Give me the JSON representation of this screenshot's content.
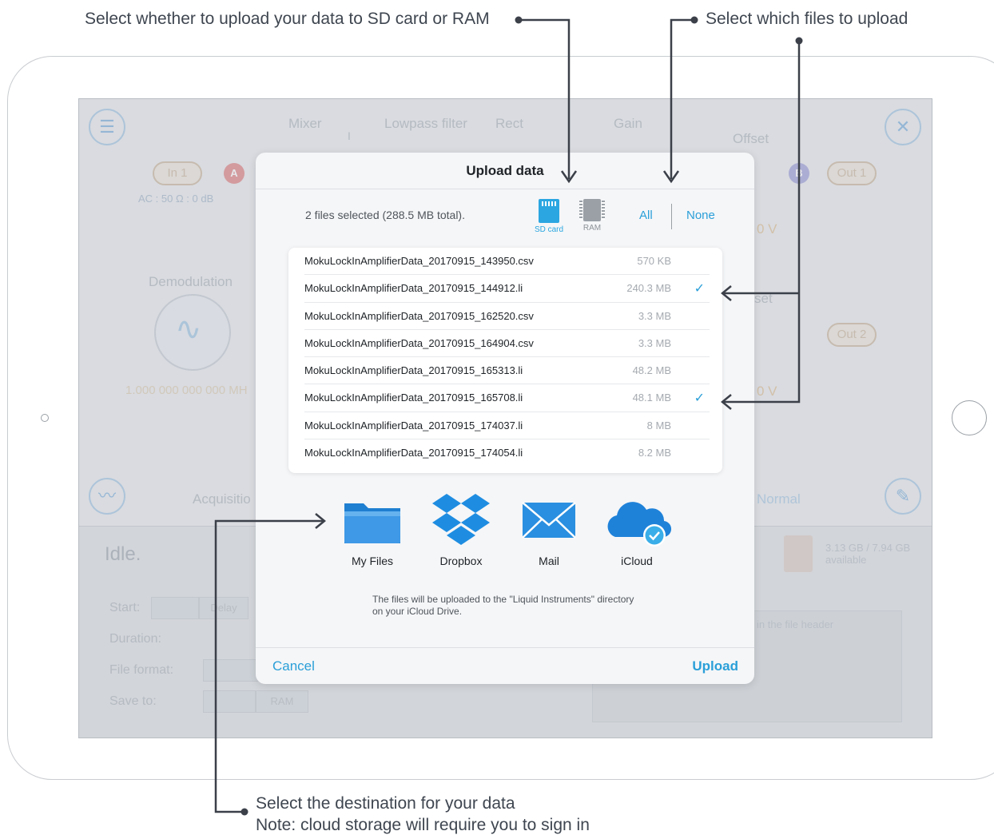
{
  "callouts": {
    "storage": "Select whether to upload your data to SD card or RAM",
    "files": "Select which files to upload",
    "destination_line1": "Select the destination for your data",
    "destination_line2": "Note: cloud storage will require you to sign in"
  },
  "background": {
    "labels": {
      "mixer": "Mixer",
      "lowpass": "Lowpass filter",
      "rect": "Rect",
      "gain": "Gain",
      "offset": "Offset",
      "offset2": "set",
      "demodulation": "Demodulation",
      "acquisition": "Acquisitio",
      "normal": "Normal",
      "idle": "Idle.",
      "in1": "In 1",
      "out1": "Out 1",
      "out2": "Out 2",
      "badge_a": "A",
      "badge_b": "B",
      "input_settings": "AC : 50 Ω : 0 dB",
      "frequency": "1.000 000 000 000 MH",
      "volt1": "0 V",
      "volt2": "0 V",
      "mixer_i": "I",
      "storage_info": "3.13 GB / 7.94 GB",
      "storage_available": "available",
      "start": "Start:",
      "start_delay": "Delay",
      "duration": "Duration:",
      "file_format": "File format:",
      "save_to": "Save to:",
      "save_to_value": "RAM",
      "file_header_hint": "in the file header"
    }
  },
  "modal": {
    "title": "Upload data",
    "selection_summary": "2 files selected (288.5 MB total).",
    "storage_options": [
      {
        "label": "SD card",
        "selected": true
      },
      {
        "label": "RAM",
        "selected": false
      }
    ],
    "select_all": "All",
    "select_none": "None",
    "files": [
      {
        "name": "MokuLockInAmplifierData_20170915_143950.csv",
        "size": "570 KB",
        "checked": false
      },
      {
        "name": "MokuLockInAmplifierData_20170915_144912.li",
        "size": "240.3 MB",
        "checked": true
      },
      {
        "name": "MokuLockInAmplifierData_20170915_162520.csv",
        "size": "3.3 MB",
        "checked": false
      },
      {
        "name": "MokuLockInAmplifierData_20170915_164904.csv",
        "size": "3.3 MB",
        "checked": false
      },
      {
        "name": "MokuLockInAmplifierData_20170915_165313.li",
        "size": "48.2 MB",
        "checked": false
      },
      {
        "name": "MokuLockInAmplifierData_20170915_165708.li",
        "size": "48.1 MB",
        "checked": true
      },
      {
        "name": "MokuLockInAmplifierData_20170915_174037.li",
        "size": "8 MB",
        "checked": false
      },
      {
        "name": "MokuLockInAmplifierData_20170915_174054.li",
        "size": "8.2 MB",
        "checked": false
      }
    ],
    "destinations": [
      {
        "label": "My Files",
        "icon": "folder-icon"
      },
      {
        "label": "Dropbox",
        "icon": "dropbox-icon"
      },
      {
        "label": "Mail",
        "icon": "mail-icon"
      },
      {
        "label": "iCloud",
        "icon": "icloud-icon",
        "selected": true
      }
    ],
    "upload_note": "The files will be uploaded to the \"Liquid Instruments\" directory on your iCloud Drive.",
    "cancel": "Cancel",
    "upload": "Upload"
  },
  "colors": {
    "accent": "#2a9fd8",
    "text": "#1e2226",
    "annotation": "#3f4650"
  }
}
